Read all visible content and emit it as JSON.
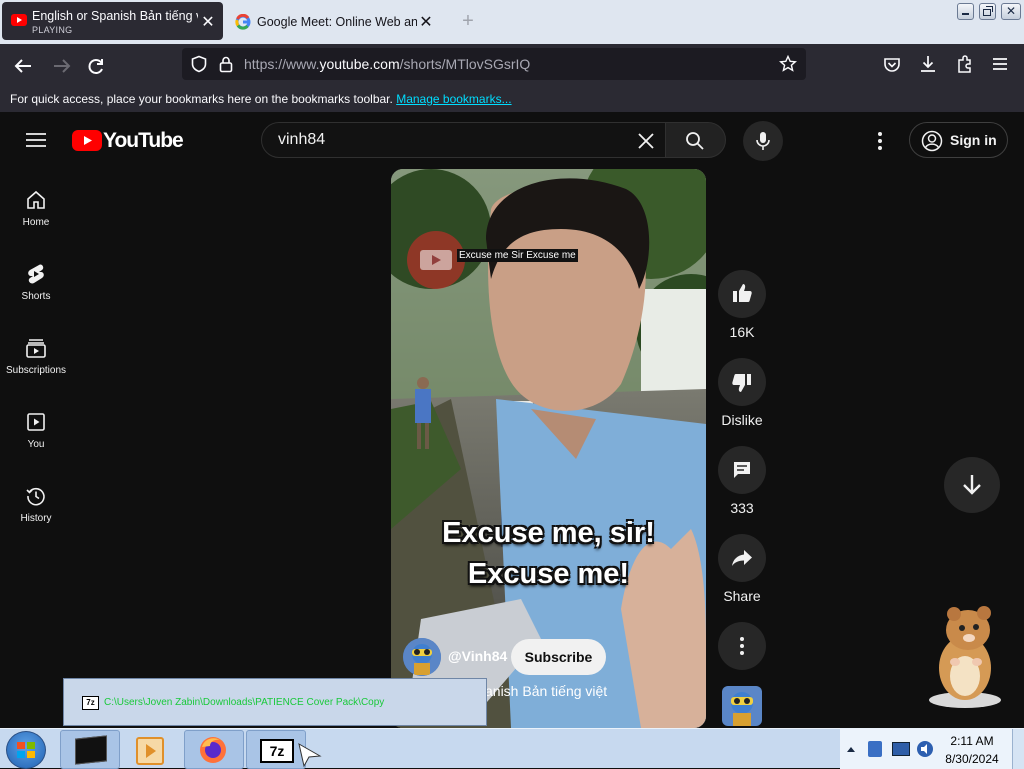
{
  "browser": {
    "tabs": [
      {
        "title": "English or Spanish Bản tiếng việt",
        "status": "PLAYING",
        "favicon": "youtube-favicon-icon",
        "active": true
      },
      {
        "title": "Google Meet: Online Web and V",
        "favicon": "google-favicon-icon",
        "active": false
      }
    ],
    "url": {
      "prefix": "https://www.",
      "domain": "youtube.com",
      "path": "/shorts/MTlovSGsrIQ"
    },
    "bookmarks_message": "For quick access, place your bookmarks here on the bookmarks toolbar.",
    "bookmarks_link": "Manage bookmarks..."
  },
  "youtube": {
    "logo_text": "YouTube",
    "search_value": "vinh84",
    "signin_label": "Sign in",
    "sidebar": [
      {
        "label": "Home",
        "icon": "home-icon"
      },
      {
        "label": "Shorts",
        "icon": "shorts-icon"
      },
      {
        "label": "Subscriptions",
        "icon": "subscriptions-icon"
      },
      {
        "label": "You",
        "icon": "you-icon"
      },
      {
        "label": "History",
        "icon": "history-icon"
      }
    ],
    "short": {
      "overlay_caption": "Excuse me Sir Excuse me",
      "subtitle_line1": "Excuse me, sir!",
      "subtitle_line2": "Excuse me!",
      "channel": "@Vinh84",
      "subscribe_label": "Subscribe",
      "video_title_fragment": "anish Bản tiếng việt"
    },
    "actions": {
      "likes": "16K",
      "dislike_label": "Dislike",
      "comments": "333",
      "share_label": "Share"
    }
  },
  "taskbar": {
    "popup_path": "C:\\Users\\Joven Zabin\\Downloads\\PATIENCE Cover Pack\\Copy",
    "clock_time": "2:11 AM",
    "clock_date": "8/30/2024"
  },
  "colors": {
    "youtube_red": "#ff0000",
    "browser_dark": "#2b2a33",
    "link_cyan": "#00ddff"
  }
}
